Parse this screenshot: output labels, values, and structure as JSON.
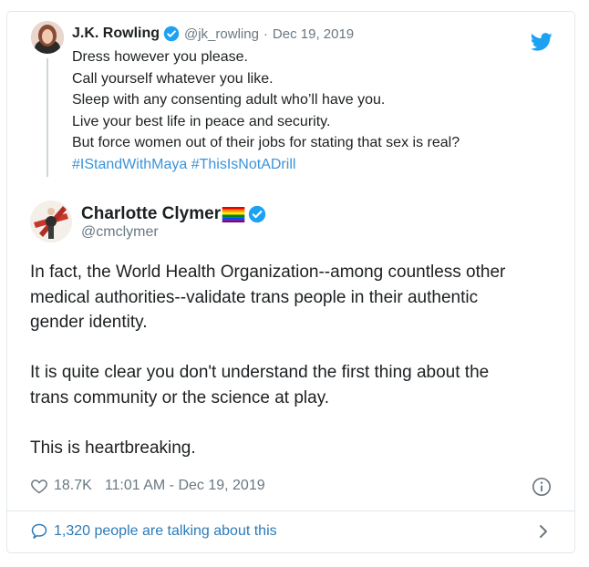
{
  "quoted_tweet": {
    "name": "J.K. Rowling",
    "handle": "@jk_rowling",
    "separator": "·",
    "date": "Dec 19, 2019",
    "lines": [
      "Dress however you please.",
      "Call yourself whatever you like.",
      "Sleep with any consenting adult who’ll have you.",
      "Live your best life in peace and security.",
      "But force women out of their jobs for stating that sex is real?"
    ],
    "hashtags": [
      "#IStandWithMaya",
      "#ThisIsNotADrill"
    ],
    "icons": {
      "verified": "verified-badge-icon",
      "brand": "twitter-bird-icon"
    }
  },
  "main_tweet": {
    "name": "Charlotte Clymer",
    "handle": "@cmclymer",
    "paragraph1_lines": [
      "In fact, the World Health Organization--among countless other",
      "medical authorities--validate trans people in their authentic",
      "gender identity."
    ],
    "paragraph2_lines": [
      "It is quite clear you don't understand the first thing about the",
      "trans community or the science at play."
    ],
    "paragraph3_lines": [
      "This is heartbreaking."
    ],
    "likes": "18.7K",
    "timestamp": "11:01 AM - Dec 19, 2019",
    "icons": {
      "rainbow": "rainbow-flag-icon",
      "verified": "verified-badge-icon",
      "like": "heart-icon",
      "info": "info-icon"
    }
  },
  "footer": {
    "talking_label": "1,320 people are talking about this",
    "icons": {
      "talk": "speech-bubble-icon",
      "more": "chevron-right-icon"
    }
  },
  "colors": {
    "link": "#3b94d9",
    "footer_link": "#2b7bb9",
    "verified": "#1da1f2",
    "muted": "#697882",
    "border": "#e1e8ed"
  }
}
